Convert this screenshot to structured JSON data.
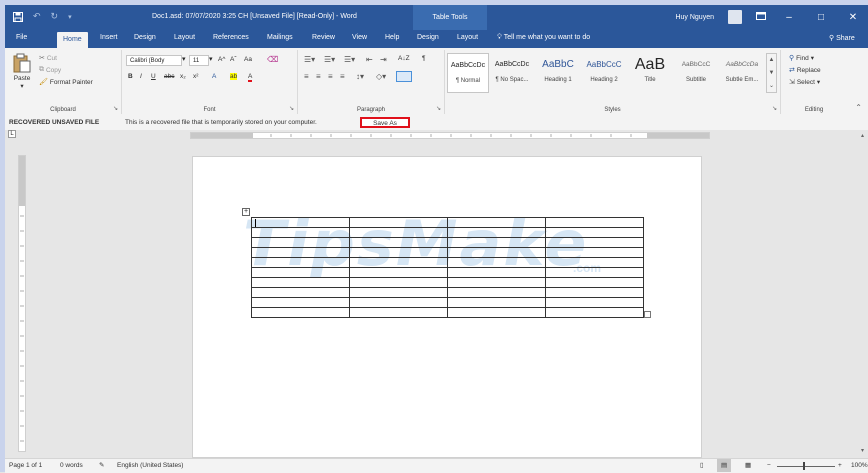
{
  "titlebar": {
    "doc_title": "Doc1.asd: 07/07/2020 3:25 CH [Unsaved File] [Read-Only] - Word",
    "context_tab_group": "Table Tools",
    "user_name": "Huy Nguyen",
    "minimize": "–",
    "restore": "□",
    "close": "✕"
  },
  "tabs": {
    "file": "File",
    "home": "Home",
    "insert": "Insert",
    "design": "Design",
    "layout": "Layout",
    "references": "References",
    "mailings": "Mailings",
    "review": "Review",
    "view": "View",
    "help": "Help",
    "table_design": "Design",
    "table_layout": "Layout",
    "tell_me": "Tell me what you want to do",
    "share": "Share"
  },
  "ribbon": {
    "clipboard": {
      "label": "Clipboard",
      "paste": "Paste",
      "cut": "Cut",
      "copy": "Copy",
      "format_painter": "Format Painter"
    },
    "font": {
      "label": "Font",
      "font_name": "Calibri (Body",
      "font_size": "11",
      "grow": "A^",
      "shrink": "Aˇ",
      "change_case": "Aa",
      "bold": "B",
      "italic": "I",
      "underline": "U",
      "strike": "abc",
      "subscript": "x₂",
      "superscript": "x²",
      "text_effects": "A",
      "highlight": "ab",
      "font_color": "A"
    },
    "paragraph": {
      "label": "Paragraph",
      "sort": "A↓Z",
      "pilcrow": "¶"
    },
    "styles": {
      "label": "Styles",
      "items": [
        {
          "sample": "AaBbCcDc",
          "name": "¶ Normal"
        },
        {
          "sample": "AaBbCcDc",
          "name": "¶ No Spac..."
        },
        {
          "sample": "AaBbC",
          "name": "Heading 1"
        },
        {
          "sample": "AaBbCcC",
          "name": "Heading 2"
        },
        {
          "sample": "AaB",
          "name": "Title"
        },
        {
          "sample": "AaBbCcC",
          "name": "Subtitle"
        },
        {
          "sample": "AaBbCcDa",
          "name": "Subtle Em..."
        }
      ]
    },
    "editing": {
      "label": "Editing",
      "find": "Find",
      "replace": "Replace",
      "select": "Select"
    }
  },
  "infobar": {
    "title": "RECOVERED UNSAVED FILE",
    "message": "This is a recovered file that is temporarily stored on your computer.",
    "save_as": "Save As"
  },
  "document": {
    "watermark": "TipsMake",
    "watermark_suffix": ".com",
    "table_anchor": "+",
    "table_rows": 10,
    "table_cols": 4
  },
  "status": {
    "page": "Page 1 of 1",
    "words": "0 words",
    "language": "English (United States)",
    "zoom_minus": "−",
    "zoom_plus": "+",
    "zoom": "100%"
  },
  "colors": {
    "title_blue": "#2b579a",
    "ribbon_bg": "#f3f3f3",
    "highlight_red": "#e0101a",
    "watermark": "#d6e6f4"
  }
}
